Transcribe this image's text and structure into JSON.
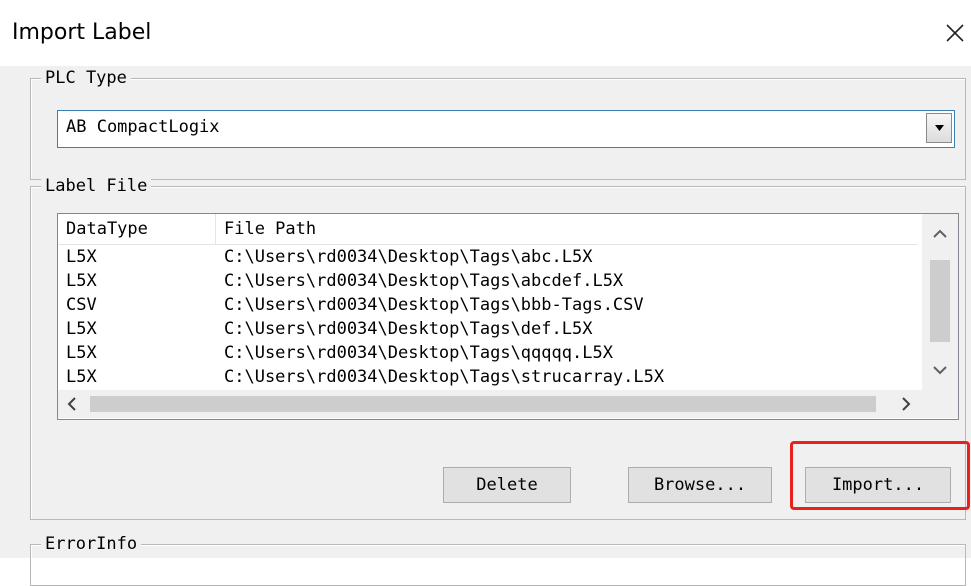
{
  "window": {
    "title": "Import Label"
  },
  "plc_type": {
    "legend": "PLC Type",
    "selected": "AB CompactLogix"
  },
  "label_file": {
    "legend": "Label File",
    "columns": [
      "DataType",
      "File Path"
    ],
    "rows": [
      {
        "type": "L5X",
        "path": "C:\\Users\\rd0034\\Desktop\\Tags\\abc.L5X"
      },
      {
        "type": "L5X",
        "path": "C:\\Users\\rd0034\\Desktop\\Tags\\abcdef.L5X"
      },
      {
        "type": "CSV",
        "path": "C:\\Users\\rd0034\\Desktop\\Tags\\bbb-Tags.CSV"
      },
      {
        "type": "L5X",
        "path": "C:\\Users\\rd0034\\Desktop\\Tags\\def.L5X"
      },
      {
        "type": "L5X",
        "path": "C:\\Users\\rd0034\\Desktop\\Tags\\qqqqq.L5X"
      },
      {
        "type": "L5X",
        "path": "C:\\Users\\rd0034\\Desktop\\Tags\\strucarray.L5X"
      }
    ]
  },
  "buttons": {
    "delete": "Delete",
    "browse": "Browse...",
    "import": "Import..."
  },
  "error_info": {
    "legend": "ErrorInfo"
  },
  "icons": {
    "close": "close-icon",
    "dropdown": "chevron-down-icon",
    "scroll_up": "chevron-up-icon",
    "scroll_down": "chevron-down-icon",
    "scroll_left": "chevron-left-icon",
    "scroll_right": "chevron-right-icon"
  },
  "colors": {
    "highlight": "#e8211f",
    "dialog_bg": "#f0f0f0",
    "select_border": "#3c7fb1"
  }
}
